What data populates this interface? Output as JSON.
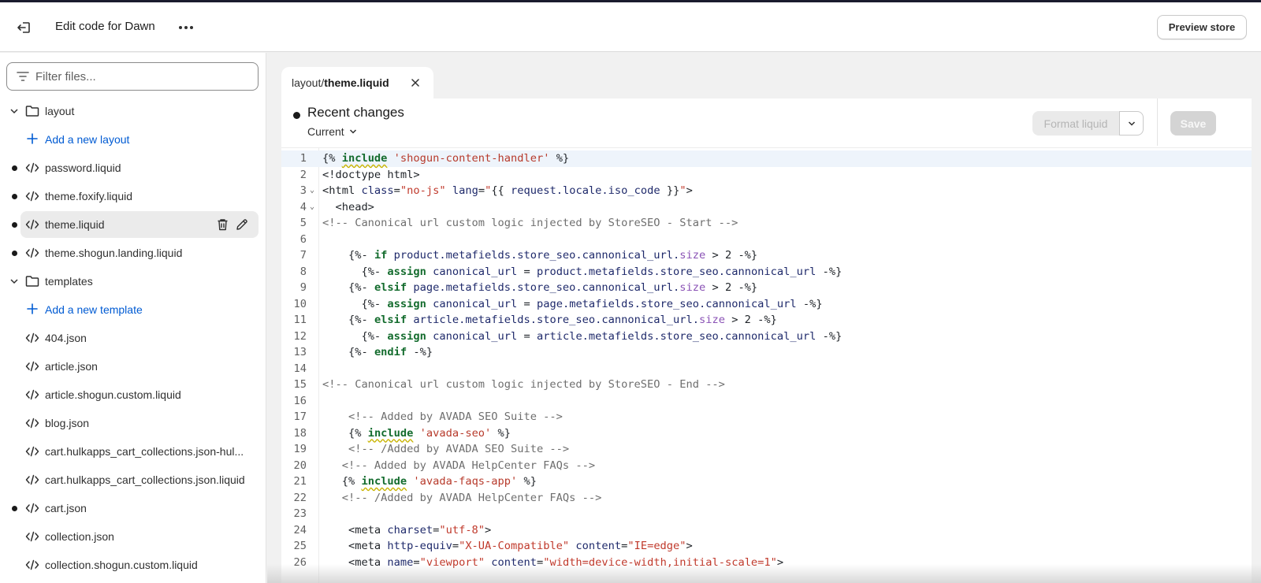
{
  "header": {
    "title": "Edit code for Dawn",
    "preview_label": "Preview store",
    "icons": {
      "exit": "exit-icon",
      "more": "more-horizontal-icon"
    }
  },
  "sidebar": {
    "filter_placeholder": "Filter files...",
    "items": [
      {
        "type": "folder",
        "label": "layout",
        "expanded": true
      },
      {
        "type": "add",
        "label": "Add a new layout"
      },
      {
        "type": "file",
        "label": "password.liquid",
        "modified": true
      },
      {
        "type": "file",
        "label": "theme.foxify.liquid",
        "modified": true
      },
      {
        "type": "file",
        "label": "theme.liquid",
        "modified": true,
        "selected": true
      },
      {
        "type": "file",
        "label": "theme.shogun.landing.liquid",
        "modified": true
      },
      {
        "type": "folder",
        "label": "templates",
        "expanded": true
      },
      {
        "type": "add",
        "label": "Add a new template"
      },
      {
        "type": "file",
        "label": "404.json",
        "modified": false
      },
      {
        "type": "file",
        "label": "article.json",
        "modified": false
      },
      {
        "type": "file",
        "label": "article.shogun.custom.liquid",
        "modified": false
      },
      {
        "type": "file",
        "label": "blog.json",
        "modified": false
      },
      {
        "type": "file",
        "label": "cart.hulkapps_cart_collections.json-hul...",
        "modified": false
      },
      {
        "type": "file",
        "label": "cart.hulkapps_cart_collections.json.liquid",
        "modified": false
      },
      {
        "type": "file",
        "label": "cart.json",
        "modified": true
      },
      {
        "type": "file",
        "label": "collection.json",
        "modified": false
      },
      {
        "type": "file",
        "label": "collection.shogun.custom.liquid",
        "modified": false
      }
    ]
  },
  "editor": {
    "tab": {
      "path_prefix": "layout/",
      "path_file": "theme.liquid"
    },
    "recent_changes": "Recent changes",
    "version": "Current",
    "format_label": "Format liquid",
    "save_label": "Save",
    "lines": [
      {
        "n": "1"
      },
      {
        "n": "2"
      },
      {
        "n": "3"
      },
      {
        "n": "4"
      },
      {
        "n": "5"
      },
      {
        "n": "6"
      },
      {
        "n": "7"
      },
      {
        "n": "8"
      },
      {
        "n": "9"
      },
      {
        "n": "10"
      },
      {
        "n": "11"
      },
      {
        "n": "12"
      },
      {
        "n": "13"
      },
      {
        "n": "14"
      },
      {
        "n": "15"
      },
      {
        "n": "16"
      },
      {
        "n": "17"
      },
      {
        "n": "18"
      },
      {
        "n": "19"
      },
      {
        "n": "20"
      },
      {
        "n": "21"
      },
      {
        "n": "22"
      },
      {
        "n": "23"
      },
      {
        "n": "24"
      },
      {
        "n": "25"
      },
      {
        "n": "26"
      }
    ]
  }
}
